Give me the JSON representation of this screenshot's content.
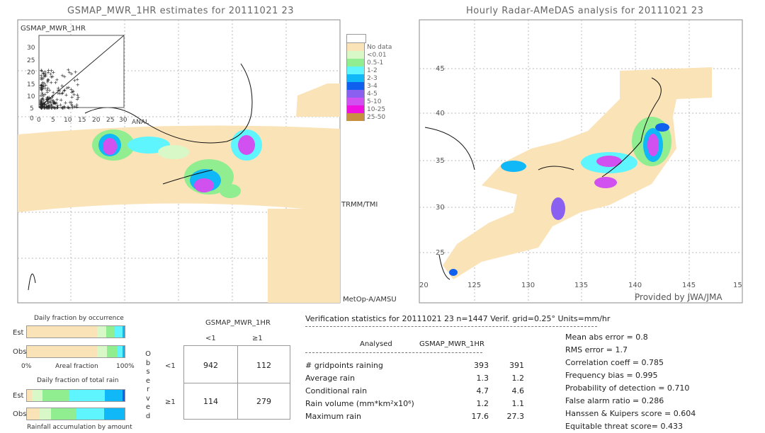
{
  "left_map": {
    "title": "GSMAP_MWR_1HR estimates for 20111021 23",
    "inset_label": "GSMAP_MWR_1HR",
    "inset_y_ticks": [
      "30",
      "25",
      "20",
      "15",
      "10",
      "5",
      "0"
    ],
    "inset_x_ticks": [
      "0",
      "5",
      "10",
      "15",
      "20",
      "25",
      "30"
    ],
    "inset_x_label": "ANAL",
    "sensor_labels": [
      "TRMM/TMI",
      "MetOp-A/AMSU-A/MHS"
    ]
  },
  "right_map": {
    "title": "Hourly Radar-AMeDAS analysis for 20111021 23",
    "lat_ticks": [
      "45",
      "40",
      "35",
      "30",
      "25"
    ],
    "lon_ticks": [
      "20",
      "125",
      "130",
      "135",
      "140",
      "145",
      "15"
    ],
    "credit": "Provided by JWA/JMA"
  },
  "legend": {
    "items": [
      {
        "label": "No data",
        "color": "#fbe3b8"
      },
      {
        "label": "<0.01",
        "color": "#d8f8c8"
      },
      {
        "label": "0.5-1",
        "color": "#90ee90"
      },
      {
        "label": "1-2",
        "color": "#5ff5ff"
      },
      {
        "label": "2-3",
        "color": "#10b8f8"
      },
      {
        "label": "3-4",
        "color": "#1060f0"
      },
      {
        "label": "4-5",
        "color": "#8a60f0"
      },
      {
        "label": "5-10",
        "color": "#d050f0"
      },
      {
        "label": "10-25",
        "color": "#f010e0"
      },
      {
        "label": "25-50",
        "color": "#c89040"
      }
    ]
  },
  "occurrence": {
    "title": "Daily fraction by occurrence",
    "est_label": "Est",
    "obs_label": "Obs",
    "axis_left": "0%",
    "axis_mid": "Areal fraction",
    "axis_right": "100%",
    "est": [
      72,
      9,
      9,
      8,
      2
    ],
    "obs": [
      72,
      10,
      11,
      5,
      2
    ]
  },
  "total_rain": {
    "title": "Daily fraction of total rain",
    "est_label": "Est",
    "obs_label": "Obs",
    "footer": "Rainfall accumulation by amount",
    "est": [
      5,
      11,
      27,
      37,
      18,
      2
    ],
    "obs": [
      13,
      12,
      26,
      28,
      21
    ]
  },
  "bar_colors": [
    "#fbe3b8",
    "#d8f8c8",
    "#90ee90",
    "#5ff5ff",
    "#10b8f8",
    "#1060f0"
  ],
  "contingency": {
    "title": "GSMAP_MWR_1HR",
    "col_headers": [
      "<1",
      "≥1"
    ],
    "row_headers": [
      "<1",
      "≥1"
    ],
    "side_label": [
      "O",
      "b",
      "s",
      "e",
      "r",
      "v",
      "e",
      "d"
    ],
    "cells": [
      [
        "942",
        "112"
      ],
      [
        "114",
        "279"
      ]
    ]
  },
  "stats": {
    "header": "Verification statistics for 20111021 23  n=1447  Verif. grid=0.25°  Units=mm/hr",
    "col_analysed": "Analysed",
    "col_est": "GSMAP_MWR_1HR",
    "rows": [
      {
        "label": "# gridpoints raining",
        "a": "393",
        "b": "391"
      },
      {
        "label": "Average rain",
        "a": "1.3",
        "b": "1.2"
      },
      {
        "label": "Conditional rain",
        "a": "4.7",
        "b": "4.6"
      },
      {
        "label": "Rain volume (mm*km²x10⁶)",
        "a": "1.2",
        "b": "1.1"
      },
      {
        "label": "Maximum rain",
        "a": "17.6",
        "b": "27.3"
      }
    ],
    "scores": [
      "Mean abs error = 0.8",
      "RMS error = 1.7",
      "Correlation coeff = 0.785",
      "Frequency bias = 0.995",
      "Probability of detection = 0.710",
      "False alarm ratio = 0.286",
      "Hanssen & Kuipers score = 0.604",
      "Equitable threat score= 0.433"
    ]
  },
  "chart_data": [
    {
      "type": "bar",
      "title": "Daily fraction by occurrence",
      "xlabel": "Areal fraction",
      "categories": [
        "Est",
        "Obs"
      ],
      "series": [
        {
          "name": "No data",
          "values": [
            72,
            72
          ]
        },
        {
          "name": "<0.01",
          "values": [
            9,
            10
          ]
        },
        {
          "name": "0.5-1",
          "values": [
            9,
            11
          ]
        },
        {
          "name": "1-2",
          "values": [
            8,
            5
          ]
        },
        {
          "name": "2-3",
          "values": [
            2,
            2
          ]
        }
      ]
    },
    {
      "type": "bar",
      "title": "Daily fraction of total rain",
      "xlabel": "Rainfall accumulation by amount",
      "categories": [
        "Est",
        "Obs"
      ],
      "series": [
        {
          "name": "No data",
          "values": [
            5,
            13
          ]
        },
        {
          "name": "<0.01",
          "values": [
            11,
            12
          ]
        },
        {
          "name": "0.5-1",
          "values": [
            27,
            26
          ]
        },
        {
          "name": "1-2",
          "values": [
            37,
            28
          ]
        },
        {
          "name": "2-3",
          "values": [
            18,
            21
          ]
        },
        {
          "name": "3-4",
          "values": [
            2,
            0
          ]
        }
      ]
    },
    {
      "type": "table",
      "title": "GSMAP_MWR_1HR",
      "rows": [
        "<1",
        "≥1"
      ],
      "columns": [
        "<1",
        "≥1"
      ],
      "values": [
        [
          942,
          112
        ],
        [
          114,
          279
        ]
      ]
    }
  ]
}
